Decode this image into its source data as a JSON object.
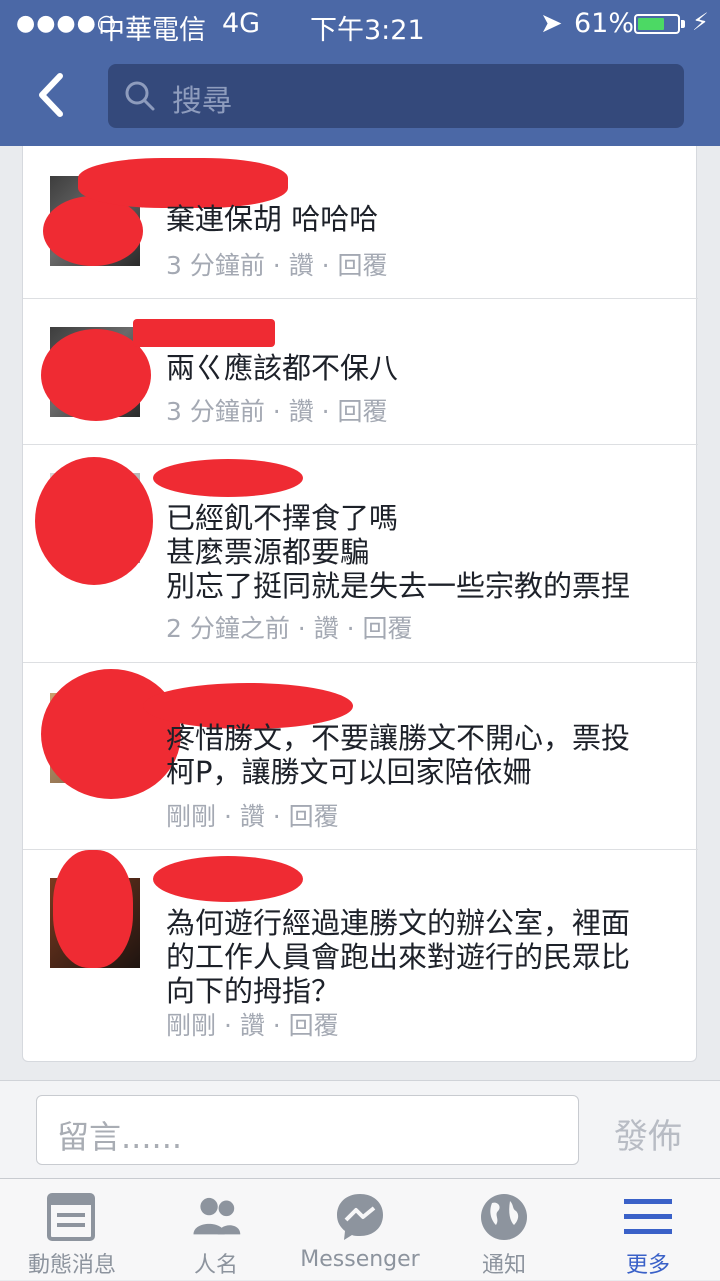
{
  "status_bar": {
    "signal": "●●●●○",
    "carrier": "中華電信",
    "network": "4G",
    "time": "下午3:21",
    "battery": "61%"
  },
  "search": {
    "placeholder": "搜尋"
  },
  "comments": [
    {
      "text": "棄連保胡  哈哈哈",
      "meta": "3 分鐘前 · 讚 · 回覆"
    },
    {
      "text": "兩ㄍ應該都不保八",
      "meta": "3 分鐘前 · 讚 · 回覆"
    },
    {
      "text": "已經飢不擇食了嗎\n甚麼票源都要騙\n別忘了挺同就是失去一些宗教的票捏",
      "meta": "2 分鐘之前 · 讚 · 回覆"
    },
    {
      "text": "疼惜勝文，不要讓勝文不開心，票投\n柯P，讓勝文可以回家陪依姍",
      "meta": "剛剛 · 讚 · 回覆"
    },
    {
      "text": "為何遊行經過連勝文的辦公室，裡面\n的工作人員會跑出來對遊行的民眾比\n向下的拇指？",
      "meta": "剛剛 · 讚 · 回覆"
    }
  ],
  "composer": {
    "placeholder": "留言......",
    "post_label": "發佈"
  },
  "tabs": [
    {
      "label": "動態消息"
    },
    {
      "label": "人名"
    },
    {
      "label": "Messenger"
    },
    {
      "label": "通知"
    },
    {
      "label": "更多"
    }
  ],
  "colors": {
    "nav_bar": "#4b68a6",
    "redaction": "#ef2b33",
    "active_tab": "#3a61c8"
  }
}
